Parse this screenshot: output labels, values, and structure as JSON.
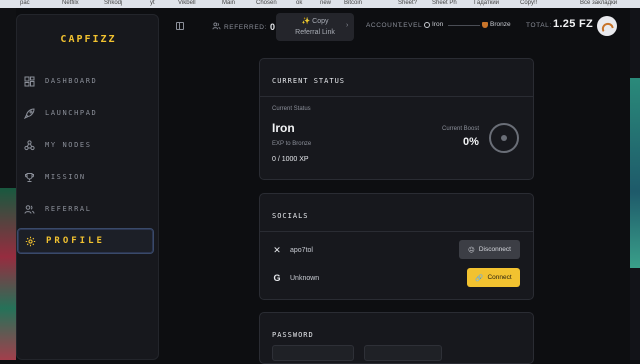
{
  "browser": {
    "bookmarks": [
      "рас",
      "Netfilx",
      "Shkodj",
      "yt",
      "Vikbell",
      "Main",
      "Сhosen",
      "ok",
      "new",
      "Bitcoin",
      "Sheet?",
      "Sheet Ph",
      "Гадаткий",
      "Copy!!",
      "Все закладки"
    ]
  },
  "brand": {
    "logo": "CAPFIZZ",
    "accent": "#f2c230"
  },
  "sidebar": {
    "items": [
      {
        "label": "DASHBOARD",
        "icon": "grid-icon",
        "active": false
      },
      {
        "label": "LAUNCHPAD",
        "icon": "rocket-icon",
        "active": false
      },
      {
        "label": "MY NODES",
        "icon": "nodes-icon",
        "active": false
      },
      {
        "label": "MISSION",
        "icon": "trophy-icon",
        "active": false
      },
      {
        "label": "REFERRAL",
        "icon": "users-icon",
        "active": false
      },
      {
        "label": "PROFILE",
        "icon": "gear-icon",
        "active": true
      }
    ]
  },
  "topbar": {
    "referred_label": "REFERRED:",
    "referred_value": "0",
    "copy_tooltip_line1": "Copy",
    "copy_tooltip_line2": "Referral Link",
    "account_label": "ACCOUNT",
    "level_label": "LEVEL",
    "level_current": "Iron",
    "level_next": "Bronze",
    "total_label": "TOTAL:",
    "total_value": "1.25 FZ"
  },
  "status_card": {
    "title": "CURRENT STATUS",
    "status_label": "Current Status",
    "status_value": "Iron",
    "exp_label": "EXP to Bronze",
    "exp_value": "0 / 1000 XP",
    "boost_label": "Current Boost",
    "boost_value": "0%"
  },
  "socials_card": {
    "title": "SOCIALS",
    "rows": [
      {
        "icon": "x-icon",
        "name": "apo7tol",
        "button": "Disconnect"
      },
      {
        "icon": "google-icon",
        "name": "Unknown",
        "button": "Connect"
      }
    ]
  },
  "password_card": {
    "title": "PASSWORD"
  }
}
